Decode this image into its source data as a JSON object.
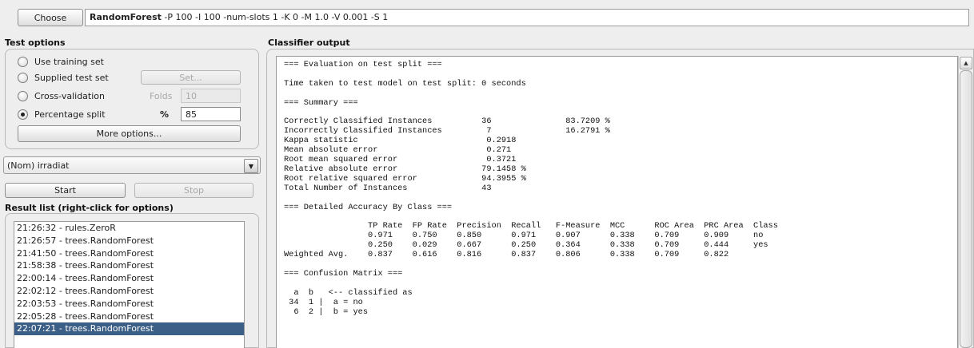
{
  "classifier": {
    "choose_label": "Choose",
    "name": "RandomForest",
    "options": " -P 100 -I 100 -num-slots 1 -K 0 -M 1.0 -V 0.001 -S 1"
  },
  "test_options": {
    "title": "Test options",
    "use_training_set": "Use training set",
    "supplied_test_set": "Supplied test set",
    "set_button": "Set...",
    "cross_validation": "Cross-validation",
    "folds_label": "Folds",
    "folds_value": "10",
    "percentage_split": "Percentage split",
    "percent_symbol": "%",
    "percent_value": "85",
    "more_options": "More options...",
    "selected": "Percentage split"
  },
  "class_attribute": {
    "value": "(Nom) irradiat"
  },
  "actions": {
    "start": "Start",
    "stop": "Stop"
  },
  "result_list": {
    "title": "Result list (right-click for options)",
    "items": [
      "21:26:32 - rules.ZeroR",
      "21:26:57 - trees.RandomForest",
      "21:41:50 - trees.RandomForest",
      "21:58:38 - trees.RandomForest",
      "22:00:14 - trees.RandomForest",
      "22:02:12 - trees.RandomForest",
      "22:03:53 - trees.RandomForest",
      "22:05:28 - trees.RandomForest",
      "22:07:21 - trees.RandomForest"
    ],
    "selected_index": 8
  },
  "output": {
    "title": "Classifier output",
    "text": "=== Evaluation on test split ===\n\nTime taken to test model on test split: 0 seconds\n\n=== Summary ===\n\nCorrectly Classified Instances          36               83.7209 %\nIncorrectly Classified Instances         7               16.2791 %\nKappa statistic                          0.2918\nMean absolute error                      0.271\nRoot mean squared error                  0.3721\nRelative absolute error                 79.1458 %\nRoot relative squared error             94.3955 %\nTotal Number of Instances               43\n\n=== Detailed Accuracy By Class ===\n\n                 TP Rate  FP Rate  Precision  Recall   F-Measure  MCC      ROC Area  PRC Area  Class\n                 0.971    0.750    0.850      0.971    0.907      0.338    0.709     0.909     no\n                 0.250    0.029    0.667      0.250    0.364      0.338    0.709     0.444     yes\nWeighted Avg.    0.837    0.616    0.816      0.837    0.806      0.338    0.709     0.822\n\n=== Confusion Matrix ===\n\n  a  b   <-- classified as\n 34  1 |  a = no\n  6  2 |  b = yes"
  },
  "icons": {
    "dropdown": "chevron-down-icon",
    "scroll_up": "scroll-up-icon"
  }
}
